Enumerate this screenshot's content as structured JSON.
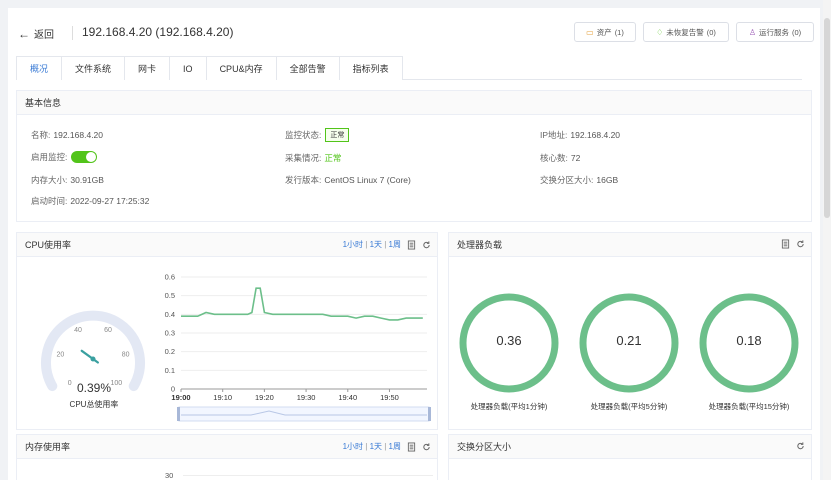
{
  "header": {
    "back_label": "返回",
    "title": "192.168.4.20 (192.168.4.20)",
    "buttons": [
      {
        "icon": "box-icon",
        "label": "资产",
        "count": "(1)"
      },
      {
        "icon": "bell-icon",
        "label": "未恢复告警",
        "count": "(0)"
      },
      {
        "icon": "user-icon",
        "label": "运行服务",
        "count": "(0)"
      }
    ]
  },
  "tabs": [
    "概况",
    "文件系统",
    "网卡",
    "IO",
    "CPU&内存",
    "全部告警",
    "指标列表"
  ],
  "basic_info": {
    "title": "基本信息",
    "name_label": "名称:",
    "name_value": "192.168.4.20",
    "monitor_label": "监控状态:",
    "monitor_value": "正常",
    "ip_label": "IP地址:",
    "ip_value": "192.168.4.20",
    "enable_label": "启用监控:",
    "collect_label": "采集情况:",
    "collect_value": "正常",
    "cores_label": "核心数:",
    "cores_value": "72",
    "mem_label": "内存大小:",
    "mem_value": "30.91GB",
    "os_label": "发行版本:",
    "os_value": "CentOS Linux 7 (Core)",
    "swap_label": "交换分区大小:",
    "swap_value": "16GB",
    "boot_label": "启动时间:",
    "boot_value": "2022-09-27 17:25:32"
  },
  "cpu_panel": {
    "title": "CPU使用率",
    "range": [
      "1小时",
      "1天",
      "1周"
    ],
    "gauge_value": "0.39%",
    "gauge_label": "CPU总使用率",
    "gauge_ticks": [
      "0",
      "20",
      "40",
      "60",
      "80",
      "100"
    ],
    "gauge_percent": 0.39
  },
  "load_panel": {
    "title": "处理器负载",
    "items": [
      {
        "value": "0.36",
        "label": "处理器负载(平均1分钟)"
      },
      {
        "value": "0.21",
        "label": "处理器负载(平均5分钟)"
      },
      {
        "value": "0.18",
        "label": "处理器负载(平均15分钟)"
      }
    ]
  },
  "mem_panel": {
    "title": "内存使用率",
    "range": [
      "1小时",
      "1天",
      "1周"
    ],
    "y_first_tick": "30"
  },
  "swap_panel": {
    "title": "交换分区大小"
  },
  "colors": {
    "accent": "#3a7bd5",
    "green": "#52c41a",
    "line": "#6cbf8a",
    "ring": "#6cbf8a"
  },
  "chart_data": {
    "type": "line",
    "title": "",
    "xlabel": "",
    "ylabel": "",
    "ylim": [
      0,
      0.6
    ],
    "yticks": [
      "0",
      "0.1",
      "0.2",
      "0.3",
      "0.4",
      "0.5",
      "0.6"
    ],
    "xticks": [
      "19:00",
      "19:10",
      "19:20",
      "19:30",
      "19:40",
      "19:50"
    ],
    "series": [
      {
        "x": [
          "19:00",
          "19:02",
          "19:04",
          "19:06",
          "19:08",
          "19:10",
          "19:12",
          "19:14",
          "19:16",
          "19:17",
          "19:18",
          "19:19",
          "19:20",
          "19:22",
          "19:24",
          "19:26",
          "19:28",
          "19:30",
          "19:32",
          "19:34",
          "19:36",
          "19:38",
          "19:40",
          "19:42",
          "19:44",
          "19:46",
          "19:48",
          "19:50",
          "19:52",
          "19:54",
          "19:56",
          "19:58"
        ],
        "values": [
          0.39,
          0.39,
          0.39,
          0.41,
          0.4,
          0.4,
          0.4,
          0.4,
          0.4,
          0.41,
          0.54,
          0.54,
          0.41,
          0.4,
          0.4,
          0.4,
          0.4,
          0.4,
          0.4,
          0.4,
          0.39,
          0.39,
          0.39,
          0.38,
          0.39,
          0.39,
          0.38,
          0.37,
          0.37,
          0.38,
          0.38,
          0.38
        ]
      }
    ]
  }
}
